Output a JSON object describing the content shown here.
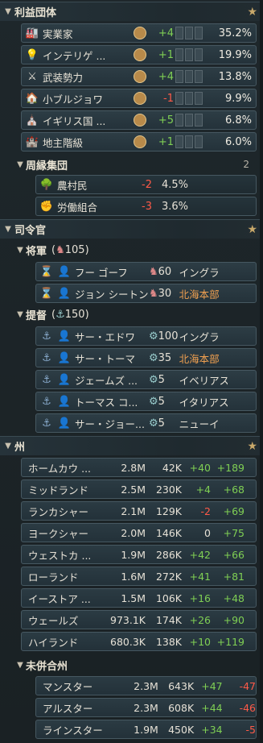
{
  "interest_groups": {
    "title": "利益団体",
    "rows": [
      {
        "icon": "industrialist-icon",
        "name": "実業家",
        "change": "+4",
        "pct": "35.2%"
      },
      {
        "icon": "intelligentsia-icon",
        "name": "インテリゲ ...",
        "change": "+1",
        "pct": "19.9%"
      },
      {
        "icon": "armed-forces-icon",
        "name": "武装勢力",
        "change": "+4",
        "pct": "13.8%"
      },
      {
        "icon": "petite-bourgeoisie-icon",
        "name": "小ブルジョワ",
        "change": "-1",
        "pct": "9.9%"
      },
      {
        "icon": "church-icon",
        "name": "イギリス国 ...",
        "change": "+5",
        "pct": "6.8%"
      },
      {
        "icon": "landowners-icon",
        "name": "地主階級",
        "change": "+1",
        "pct": "6.0%"
      }
    ],
    "marginal": {
      "title": "周縁集団",
      "count": "2",
      "rows": [
        {
          "icon": "rural-folk-icon",
          "name": "農村民",
          "change": "-2",
          "pct": "4.5%"
        },
        {
          "icon": "trade-unions-icon",
          "name": "労働組合",
          "change": "-3",
          "pct": "3.6%"
        }
      ]
    }
  },
  "commanders": {
    "title": "司令官",
    "generals": {
      "title": "将軍",
      "total": "105",
      "rows": [
        {
          "name": "フー ゴーフ",
          "troops": "60",
          "loc": "イングラ"
        },
        {
          "name": "ジョン シートン",
          "troops": "30",
          "loc": "北海本部"
        }
      ]
    },
    "admirals": {
      "title": "提督",
      "total": "150",
      "rows": [
        {
          "name": "サー・エドワ",
          "troops": "100",
          "loc": "イングラ"
        },
        {
          "name": "サー・トーマ",
          "troops": "35",
          "loc": "北海本部"
        },
        {
          "name": "ジェームズ ...",
          "troops": "5",
          "loc": "イベリアス"
        },
        {
          "name": "トーマス コ...",
          "troops": "5",
          "loc": "イタリアス"
        },
        {
          "name": "サー・ジョー...",
          "troops": "5",
          "loc": "ニューイ"
        }
      ]
    }
  },
  "states": {
    "title": "州",
    "rows": [
      {
        "name": "ホームカウ ...",
        "pop": "2.8M",
        "a": "42K",
        "b": "+40",
        "c": "+189"
      },
      {
        "name": "ミッドランド",
        "pop": "2.5M",
        "a": "230K",
        "b": "+4",
        "c": "+68"
      },
      {
        "name": "ランカシャー",
        "pop": "2.1M",
        "a": "129K",
        "b": "-2",
        "c": "+69"
      },
      {
        "name": "ヨークシャー",
        "pop": "2.0M",
        "a": "146K",
        "b": "0",
        "c": "+75"
      },
      {
        "name": "ウェストカ ...",
        "pop": "1.9M",
        "a": "286K",
        "b": "+42",
        "c": "+66"
      },
      {
        "name": "ローランド",
        "pop": "1.6M",
        "a": "272K",
        "b": "+41",
        "c": "+81"
      },
      {
        "name": "イーストア ...",
        "pop": "1.5M",
        "a": "106K",
        "b": "+16",
        "c": "+48"
      },
      {
        "name": "ウェールズ",
        "pop": "973.1K",
        "a": "174K",
        "b": "+26",
        "c": "+90"
      },
      {
        "name": "ハイランド",
        "pop": "680.3K",
        "a": "138K",
        "b": "+10",
        "c": "+119"
      }
    ],
    "unincorporated": {
      "title": "未併合州",
      "rows": [
        {
          "name": "マンスター",
          "pop": "2.3M",
          "a": "643K",
          "b": "+47",
          "c": "-47"
        },
        {
          "name": "アルスター",
          "pop": "2.3M",
          "a": "608K",
          "b": "+44",
          "c": "-46"
        },
        {
          "name": "ラインスター",
          "pop": "1.9M",
          "a": "450K",
          "b": "+34",
          "c": "-5"
        }
      ]
    }
  }
}
